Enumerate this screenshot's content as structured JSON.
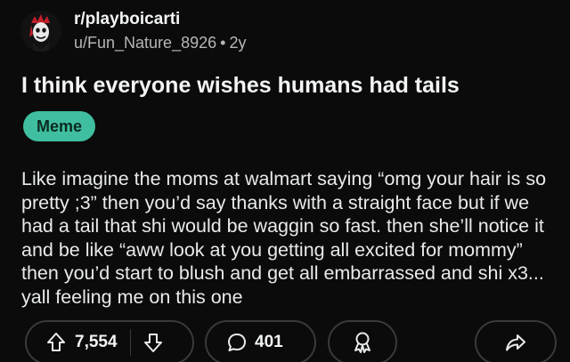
{
  "post": {
    "subreddit": "r/playboicarti",
    "username": "u/Fun_Nature_8926",
    "separator": "•",
    "age": "2y",
    "title": "I think everyone wishes humans had tails",
    "flair": "Meme",
    "body": "Like imagine the moms at walmart saying “omg your hair is so pretty ;3” then you’d say thanks with a straight face but if we had a tail that shi would be waggin so fast. then she’ll notice it and be like “aww look at you getting all excited for mommy” then you’d start to blush and get all embarrassed and shi x3... yall feeling me on this one"
  },
  "actions": {
    "upvotes": "7,554",
    "comments": "401",
    "upvote_icon": "arrow-up-icon",
    "downvote_icon": "arrow-down-icon",
    "comment_icon": "comment-bubble-icon",
    "award_icon": "award-ribbon-icon",
    "share_icon": "share-arrow-icon"
  },
  "colors": {
    "background": "#0b0b0b",
    "flair_bg": "#3fbf9f",
    "text": "#f2f4f5",
    "muted": "#b6b6b6"
  }
}
